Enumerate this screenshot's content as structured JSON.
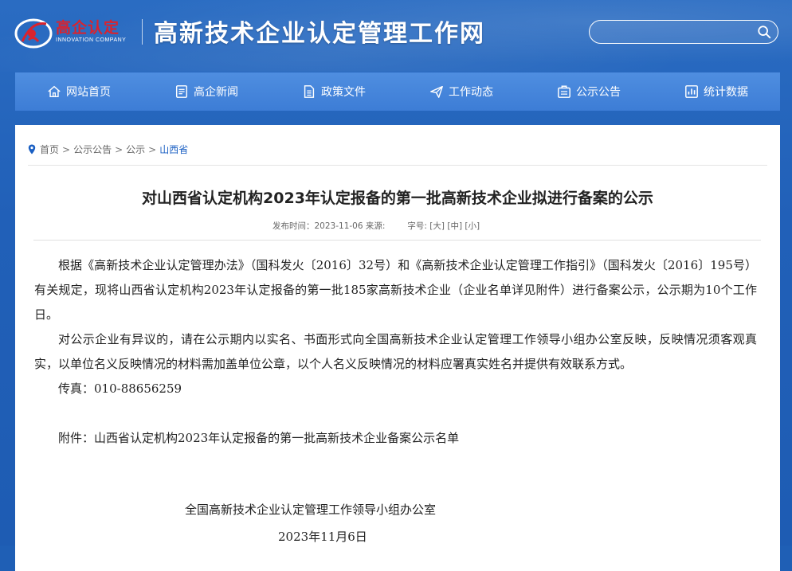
{
  "header": {
    "logo_cn": "高企认定",
    "logo_en": "INNOVATION COMPANY",
    "site_title": "高新技术企业认定管理工作网",
    "search_placeholder": ""
  },
  "nav": [
    {
      "label": "网站首页",
      "icon": "home-icon"
    },
    {
      "label": "高企新闻",
      "icon": "news-icon"
    },
    {
      "label": "政策文件",
      "icon": "document-icon"
    },
    {
      "label": "工作动态",
      "icon": "send-icon"
    },
    {
      "label": "公示公告",
      "icon": "notice-icon"
    },
    {
      "label": "统计数据",
      "icon": "chart-icon"
    }
  ],
  "breadcrumb": [
    "首页",
    "公示公告",
    "公示",
    "山西省"
  ],
  "breadcrumb_sep": ">",
  "article": {
    "title": "对山西省认定机构2023年认定报备的第一批高新技术企业拟进行备案的公示",
    "meta_date": "发布时间：2023-11-06 来源:",
    "meta_font": "字号:",
    "font_large": "[大]",
    "font_medium": "[中]",
    "font_small": "[小]",
    "paragraphs": [
      "根据《高新技术企业认定管理办法》（国科发火〔2016〕32号）和《高新技术企业认定管理工作指引》（国科发火〔2016〕195号）有关规定，现将山西省认定机构2023年认定报备的第一批185家高新技术企业（企业名单详见附件）进行备案公示，公示期为10个工作日。",
      "对公示企业有异议的，请在公示期内以实名、书面形式向全国高新技术企业认定管理工作领导小组办公室反映，反映情况须客观真实，以单位名义反映情况的材料需加盖单位公章，以个人名义反映情况的材料应署真实姓名并提供有效联系方式。",
      "传真：010-88656259",
      "",
      "附件：山西省认定机构2023年认定报备的第一批高新技术企业备案公示名单"
    ],
    "signature_org": "全国高新技术企业认定管理工作领导小组办公室",
    "signature_date": "2023年11月6日"
  },
  "colors": {
    "header_bg": "#2160b8",
    "nav_bg": "#4585dc",
    "logo_red": "#d9232e",
    "link_blue": "#1a5fc3"
  }
}
